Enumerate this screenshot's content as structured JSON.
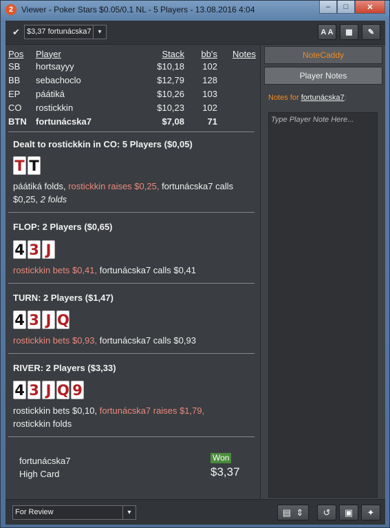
{
  "window": {
    "app_icon_label": "2",
    "title": "Viewer - Poker Stars $0.05/0.1 NL - 5 Players - 13.08.2016 4:04",
    "minimize_glyph": "–",
    "maximize_glyph": "□",
    "close_glyph": "✕"
  },
  "toolbar": {
    "checkbox_glyph": "✔",
    "player_selector": "$3,37 fortunácska7",
    "dropdown_glyph": "▾",
    "font_size_label": "A A",
    "grid_glyph": "▦",
    "edit_glyph": "✎"
  },
  "players_table": {
    "headers": {
      "pos": "Pos",
      "player": "Player",
      "stack": "Stack",
      "bbs": "bb's",
      "notes": "Notes"
    },
    "rows": [
      {
        "pos": "SB",
        "player": "hortsayyy",
        "stack": "$10,18",
        "bbs": "102"
      },
      {
        "pos": "BB",
        "player": "sebachoclo",
        "stack": "$12,79",
        "bbs": "128"
      },
      {
        "pos": "EP",
        "player": "páátiká",
        "stack": "$10,26",
        "bbs": "103"
      },
      {
        "pos": "CO",
        "player": "rostickkin",
        "stack": "$10,23",
        "bbs": "102"
      },
      {
        "pos": "BTN",
        "player": "fortunácska7",
        "stack": "$7,08",
        "bbs": "71"
      }
    ]
  },
  "preflop": {
    "title": "Dealt to rostickkin in CO: 5 Players ($0,05)",
    "cards": [
      {
        "rank": "T",
        "color": "red"
      },
      {
        "rank": "T",
        "color": "black"
      }
    ],
    "action_1": "páátiká folds, ",
    "action_2": "rostickkin raises $0,25,",
    "action_3": " fortunácska7 calls $0,25, ",
    "action_4": "2 folds"
  },
  "flop": {
    "title": "FLOP: 2 Players ($0,65)",
    "cards": [
      {
        "rank": "4",
        "color": "black"
      },
      {
        "rank": "3",
        "color": "red"
      },
      {
        "rank": "J",
        "color": "red"
      }
    ],
    "action_1": "rostickkin bets $0,41,",
    "action_2": " fortunácska7 calls $0,41"
  },
  "turn": {
    "title": "TURN: 2 Players ($1,47)",
    "cards": [
      {
        "rank": "4",
        "color": "black"
      },
      {
        "rank": "3",
        "color": "red"
      },
      {
        "rank": "J",
        "color": "red"
      },
      {
        "rank": "Q",
        "color": "red"
      }
    ],
    "action_1": "rostickkin bets $0,93,",
    "action_2": " fortunácska7 calls $0,93"
  },
  "river": {
    "title": "RIVER: 2 Players ($3,33)",
    "cards": [
      {
        "rank": "4",
        "color": "black"
      },
      {
        "rank": "3",
        "color": "red"
      },
      {
        "rank": "J",
        "color": "red"
      },
      {
        "rank": "Q",
        "color": "red"
      },
      {
        "rank": "9",
        "color": "red"
      }
    ],
    "action_1": "rostickkin bets $0,10, ",
    "action_2": "fortunácska7 raises $1,79,",
    "action_3": "rostickkin folds"
  },
  "result": {
    "winner": "fortunácska7",
    "hand": "High Card",
    "badge": "Won",
    "amount": "$3,37"
  },
  "notes_panel": {
    "tab_notecaddy": "NoteCaddy",
    "tab_player_notes": "Player Notes",
    "notes_for_label": "Notes for ",
    "notes_for_player": "fortunácska7",
    "notes_for_suffix": ":",
    "placeholder": "Type Player Note Here..."
  },
  "bottom": {
    "review_select": "For Review",
    "dropdown_glyph": "▾",
    "notes_glyph": "▤",
    "updown_glyph": "⇕",
    "replay_glyph": "↺",
    "save_glyph": "▣",
    "twitter_glyph": "✦"
  },
  "colors": {
    "highlight": "#e98a7e",
    "accent_orange": "#f08a22",
    "won_green": "#4a8c3c",
    "card_red": "#b21e23"
  }
}
